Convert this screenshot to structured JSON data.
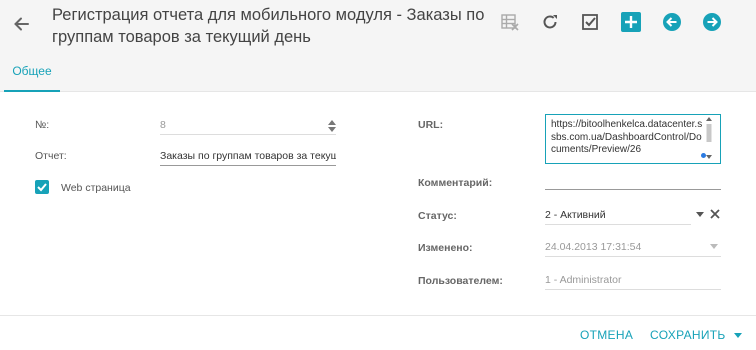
{
  "header": {
    "title": "Регистрация отчета для мобильного модуля - Заказы по группам товаров за текущий день"
  },
  "tabs": [
    {
      "label": "Общее"
    }
  ],
  "form": {
    "number_label": "№:",
    "number_value": "8",
    "report_label": "Отчет:",
    "report_value": "Заказы по группам товаров за текущи",
    "web_label": "Web страница",
    "web_checked": true,
    "url_label": "URL:",
    "url_value": "https://bitoolhenkelca.datacenter.ssbs.com.ua/DashboardControl/Documents/Preview/26",
    "comment_label": "Комментарий:",
    "comment_value": "",
    "status_label": "Статус:",
    "status_value": "2 - Активний",
    "modified_label": "Изменено:",
    "modified_value": "24.04.2013 17:31:54",
    "user_label": "Пользователем:",
    "user_value": "1 - Administrator"
  },
  "footer": {
    "cancel_label": "ОТМЕНА",
    "save_label": "СОХРАНИТЬ"
  },
  "colors": {
    "accent": "#17a2b8",
    "header_bg": "#f5f5f5"
  }
}
